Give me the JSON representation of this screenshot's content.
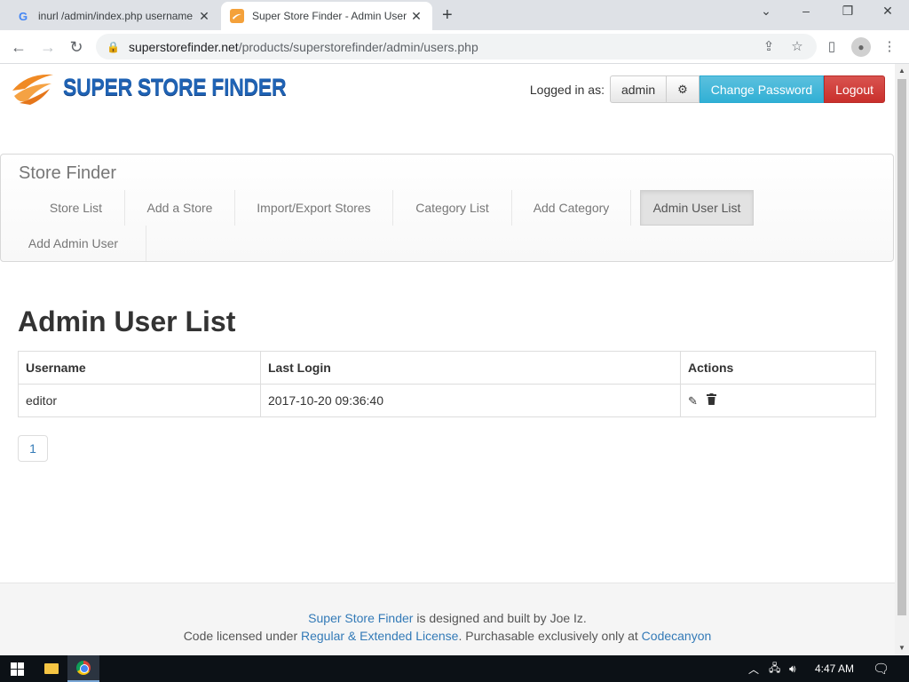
{
  "browser": {
    "tabs": [
      {
        "title": "inurl /admin/index.php username",
        "favicon": "google-g-icon",
        "active": false
      },
      {
        "title": "Super Store Finder - Admin User",
        "favicon": "superstorefinder-icon",
        "active": true
      }
    ],
    "new_tab_icon": "plus-icon",
    "url_host": "superstorefinder.net",
    "url_path": "/products/superstorefinder/admin/users.php"
  },
  "header": {
    "logo_text": "SUPER STORE FINDER",
    "logged_in_label": "Logged in as:",
    "username": "admin",
    "settings_icon": "gear-icon",
    "change_password_label": "Change Password",
    "logout_label": "Logout"
  },
  "nav": {
    "brand": "Store Finder",
    "items": [
      {
        "label": "Store List"
      },
      {
        "label": "Add a Store"
      },
      {
        "label": "Import/Export Stores"
      },
      {
        "label": "Category List"
      },
      {
        "label": "Add Category"
      },
      {
        "label": "Admin User List"
      },
      {
        "label": "Add Admin User"
      }
    ],
    "active_item": "Admin User List"
  },
  "main": {
    "title": "Admin User List",
    "table": {
      "headers": [
        "Username",
        "Last Login",
        "Actions"
      ],
      "rows": [
        {
          "username": "editor",
          "last_login": "2017-10-20 09:36:40",
          "actions": [
            "pencil-icon",
            "trash-icon"
          ]
        }
      ]
    },
    "pagination": {
      "current_page": "1"
    }
  },
  "footer": {
    "line1_link": "Super Store Finder",
    "line1_text": " is designed and built by Joe Iz.",
    "line2_prefix": "Code licensed under ",
    "line2_license_link": "Regular & Extended License",
    "line2_middle": ". Purchasable exclusively only at ",
    "line2_market_link": "Codecanyon"
  },
  "taskbar": {
    "time": "4:47 AM"
  },
  "colors": {
    "logo_blue": "#1f63b5",
    "logo_orange": "#f08a24",
    "info_button": "#31b0d5",
    "danger_button": "#d9534f",
    "link": "#337ab7"
  }
}
